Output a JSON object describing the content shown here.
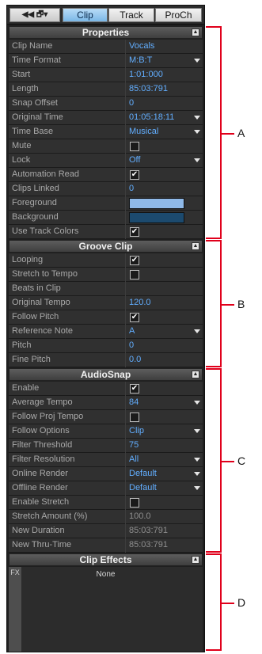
{
  "tabs": {
    "icons": "◀◀ 🗗▾",
    "clip": "Clip",
    "track": "Track",
    "proch": "ProCh"
  },
  "sections": {
    "properties": {
      "title": "Properties",
      "rows": [
        {
          "label": "Clip Name",
          "value": "Vocals"
        },
        {
          "label": "Time Format",
          "value": "M:B:T",
          "dropdown": true
        },
        {
          "label": "Start",
          "value": "1:01:000"
        },
        {
          "label": "Length",
          "value": "85:03:791"
        },
        {
          "label": "Snap Offset",
          "value": "0"
        },
        {
          "label": "Original Time",
          "value": "01:05:18:11",
          "dropdown": true
        },
        {
          "label": "Time Base",
          "value": "Musical",
          "dropdown": true
        },
        {
          "label": "Mute",
          "checkbox": false
        },
        {
          "label": "Lock",
          "value": "Off",
          "dropdown": true
        },
        {
          "label": "Automation Read",
          "checkbox": true
        },
        {
          "label": "Clips Linked",
          "value": "0"
        },
        {
          "label": "Foreground",
          "color": "#8fb9e8"
        },
        {
          "label": "Background",
          "color": "#1c4a6e"
        },
        {
          "label": "Use Track Colors",
          "checkbox": true
        }
      ]
    },
    "groove": {
      "title": "Groove Clip",
      "rows": [
        {
          "label": "Looping",
          "checkbox": true
        },
        {
          "label": "Stretch to Tempo",
          "checkbox": false
        },
        {
          "label": "Beats in Clip",
          "value": ""
        },
        {
          "label": "Original Tempo",
          "value": "120.0"
        },
        {
          "label": "Follow Pitch",
          "checkbox": true
        },
        {
          "label": "Reference Note",
          "value": "A",
          "dropdown": true
        },
        {
          "label": "Pitch",
          "value": "0"
        },
        {
          "label": "Fine Pitch",
          "value": "0.0"
        }
      ]
    },
    "audiosnap": {
      "title": "AudioSnap",
      "rows": [
        {
          "label": "Enable",
          "checkbox": true
        },
        {
          "label": "Average Tempo",
          "value": "84",
          "dropdown": true
        },
        {
          "label": "Follow Proj Tempo",
          "checkbox": false
        },
        {
          "label": "Follow Options",
          "value": "Clip",
          "dropdown": true
        },
        {
          "label": "Filter Threshold",
          "value": "75"
        },
        {
          "label": "Filter Resolution",
          "value": "All",
          "dropdown": true
        },
        {
          "label": "Online Render",
          "value": "Default",
          "dropdown": true
        },
        {
          "label": "Offline Render",
          "value": "Default",
          "dropdown": true
        },
        {
          "label": "Enable Stretch",
          "checkbox": false
        },
        {
          "label": "Stretch Amount (%)",
          "value": "100.0",
          "dim": true
        },
        {
          "label": "New Duration",
          "value": "85:03:791",
          "dim": true
        },
        {
          "label": "New Thru-Time",
          "value": "85:03:791",
          "dim": true
        }
      ]
    },
    "effects": {
      "title": "Clip Effects",
      "fx_label": "FX",
      "none_label": "None"
    }
  },
  "callouts": [
    "A",
    "B",
    "C",
    "D"
  ],
  "colors": {
    "value_blue": "#62aeff",
    "callout_red": "#e0001b"
  }
}
